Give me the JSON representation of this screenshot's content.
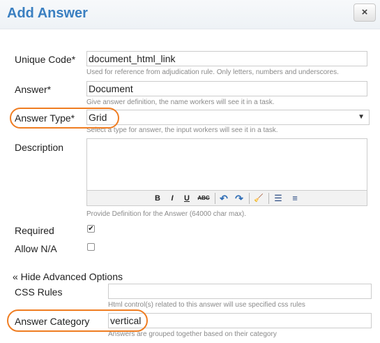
{
  "dialog": {
    "title": "Add Answer",
    "close_label": "×"
  },
  "form": {
    "unique_code": {
      "label": "Unique Code*",
      "value": "document_html_link",
      "hint": "Used for reference from adjudication rule. Only letters, numbers and underscores."
    },
    "answer": {
      "label": "Answer*",
      "value": "Document",
      "hint": "Give answer definition, the name workers will see it in a task."
    },
    "answer_type": {
      "label": "Answer Type*",
      "selected": "Grid",
      "hint": "Select a type for answer, the input workers will see it in a task."
    },
    "description": {
      "label": "Description",
      "value": "",
      "hint": "Provide Definition for the Answer (64000 char max).",
      "toolbar": {
        "bold": "B",
        "italic": "I",
        "underline": "U",
        "strike": "ABC",
        "undo": "↶",
        "redo": "↷",
        "clean": "🧹",
        "bullets": "☰",
        "numbers": "≡"
      }
    },
    "required": {
      "label": "Required",
      "checked": true,
      "mark": "✔"
    },
    "allow_na": {
      "label": "Allow N/A",
      "checked": false,
      "mark": ""
    },
    "advanced_toggle": "« Hide Advanced Options",
    "css_rules": {
      "label": "CSS Rules",
      "value": "",
      "hint": "Html control(s) related to this answer will use specified css rules"
    },
    "answer_category": {
      "label": "Answer Category",
      "value": "vertical",
      "hint": "Answers are grouped together based on their category"
    }
  },
  "colors": {
    "title": "#3a7fc1",
    "highlight": "#ef7d22"
  }
}
